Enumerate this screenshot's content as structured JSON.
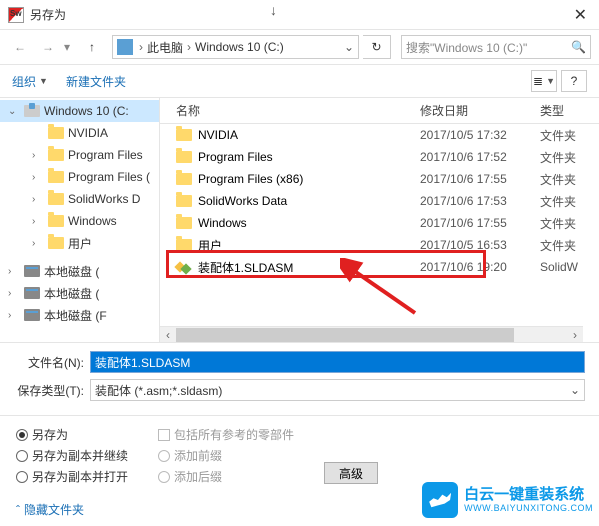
{
  "titlebar": {
    "title": "另存为"
  },
  "nav": {
    "breadcrumb": {
      "root": "此电脑",
      "drive": "Windows 10 (C:)"
    },
    "search_placeholder": "搜索\"Windows 10 (C:)\""
  },
  "toolbar": {
    "organize": "组织",
    "new_folder": "新建文件夹"
  },
  "filelist": {
    "headers": {
      "name": "名称",
      "date": "修改日期",
      "type": "类型"
    },
    "rows": [
      {
        "name": "NVIDIA",
        "date": "2017/10/5 17:32",
        "type": "文件夹",
        "icon": "folder"
      },
      {
        "name": "Program Files",
        "date": "2017/10/6 17:52",
        "type": "文件夹",
        "icon": "folder"
      },
      {
        "name": "Program Files (x86)",
        "date": "2017/10/6 17:55",
        "type": "文件夹",
        "icon": "folder"
      },
      {
        "name": "SolidWorks Data",
        "date": "2017/10/6 17:53",
        "type": "文件夹",
        "icon": "folder"
      },
      {
        "name": "Windows",
        "date": "2017/10/6 17:55",
        "type": "文件夹",
        "icon": "folder"
      },
      {
        "name": "用户",
        "date": "2017/10/5 16:53",
        "type": "文件夹",
        "icon": "folder"
      },
      {
        "name": "装配体1.SLDASM",
        "date": "2017/10/6 19:20",
        "type": "SolidW",
        "icon": "asm"
      }
    ]
  },
  "tree": {
    "items": [
      {
        "label": "Windows 10 (C:",
        "icon": "win-drive",
        "expander": "⌄",
        "selected": true,
        "indent": false
      },
      {
        "label": "NVIDIA",
        "icon": "folder",
        "expander": "",
        "indent": true
      },
      {
        "label": "Program Files",
        "icon": "folder",
        "expander": "›",
        "indent": true
      },
      {
        "label": "Program Files (",
        "icon": "folder",
        "expander": "›",
        "indent": true
      },
      {
        "label": "SolidWorks D",
        "icon": "folder",
        "expander": "›",
        "indent": true
      },
      {
        "label": "Windows",
        "icon": "folder",
        "expander": "›",
        "indent": true
      },
      {
        "label": "用户",
        "icon": "folder",
        "expander": "›",
        "indent": true
      },
      {
        "label": "本地磁盘 (",
        "icon": "drive",
        "expander": "›",
        "indent": false
      },
      {
        "label": "本地磁盘 (",
        "icon": "drive",
        "expander": "›",
        "indent": false
      },
      {
        "label": "本地磁盘 (F",
        "icon": "drive",
        "expander": "›",
        "indent": false
      }
    ]
  },
  "form": {
    "filename_label": "文件名(N):",
    "filename_value": "装配体1.SLDASM",
    "filetype_label": "保存类型(T):",
    "filetype_value": "装配体 (*.asm;*.sldasm)"
  },
  "options": {
    "radios": {
      "save_as": "另存为",
      "save_as_copy_continue": "另存为副本并继续",
      "save_as_copy_open": "另存为副本并打开"
    },
    "checks": {
      "include_refs": "包括所有参考的零部件",
      "add_prefix": "添加前缀",
      "add_suffix": "添加后缀"
    },
    "advanced": "高级"
  },
  "footer": {
    "hide_folders": "隐藏文件夹"
  },
  "watermark": {
    "line1": "白云一键重装系统",
    "line2": "WWW.BAIYUNXITONG.COM"
  }
}
